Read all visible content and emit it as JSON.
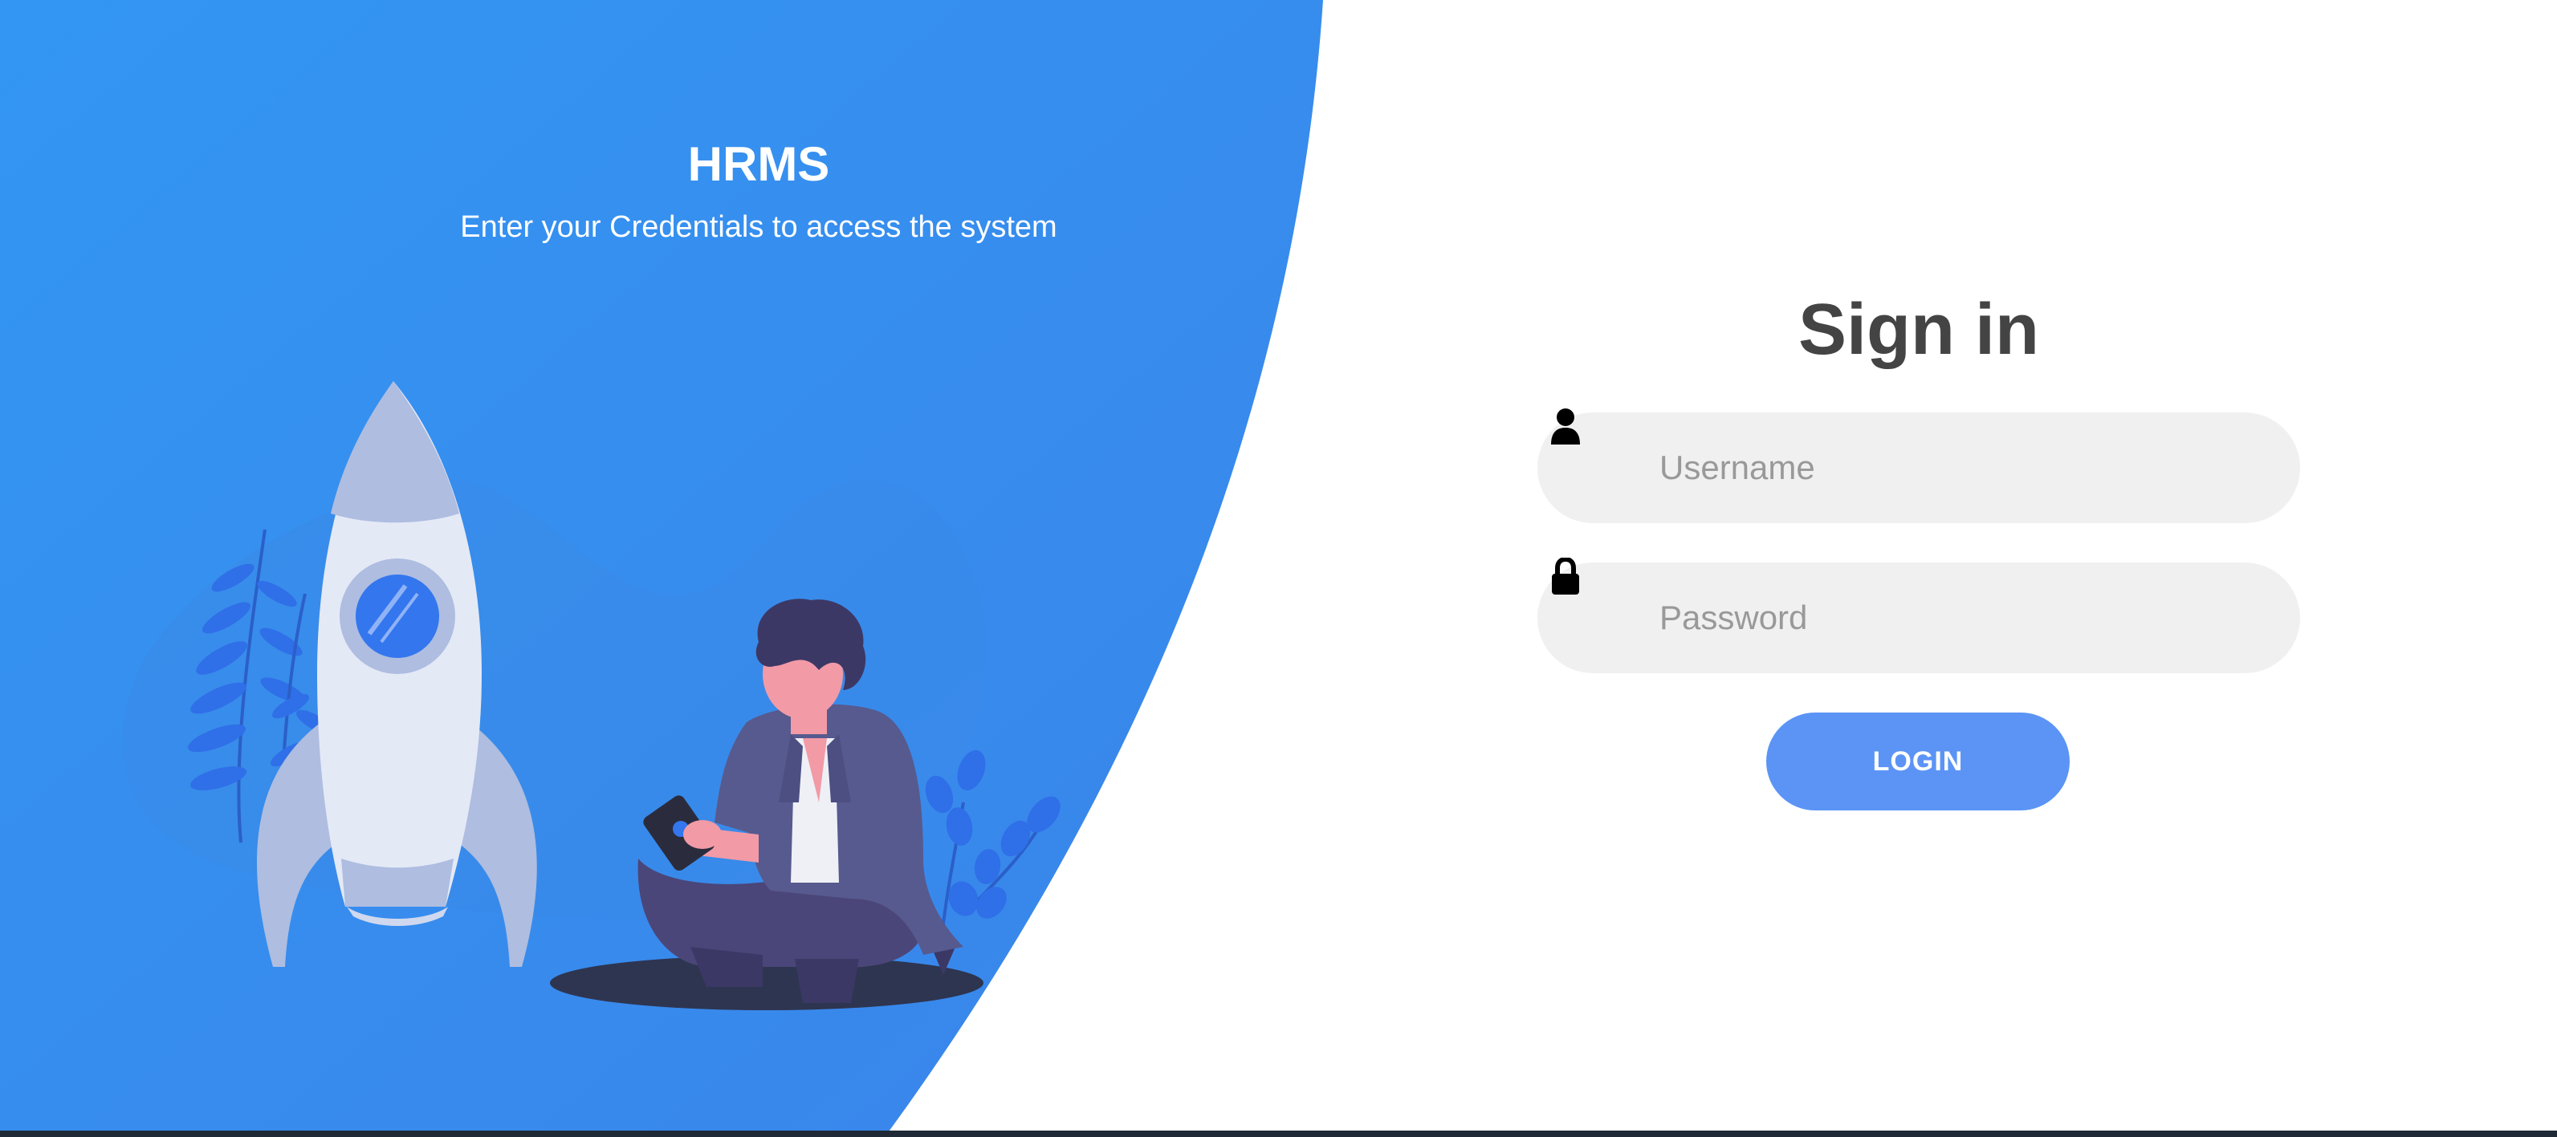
{
  "app": {
    "title": "HRMS",
    "subtitle": "Enter your Credentials to access the system"
  },
  "signin": {
    "title": "Sign in",
    "username_placeholder": "Username",
    "username_value": "",
    "password_placeholder": "Password",
    "password_value": "",
    "login_label": "LOGIN",
    "username_icon": "user-icon",
    "password_icon": "lock-icon"
  },
  "colors": {
    "panel_blue": "#3a8ef0",
    "button_blue": "#5b94f5",
    "field_bg": "#f0f0f0",
    "heading_text": "#444444"
  }
}
